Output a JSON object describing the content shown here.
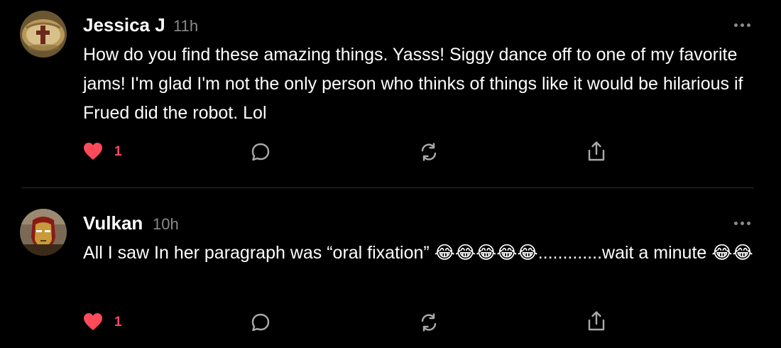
{
  "comments": [
    {
      "author": "Jessica J",
      "time": "11h",
      "text": "How do you find these amazing things. Yasss! Siggy dance off to one of my favorite jams! I'm glad I'm not the only person who thinks of things like it would be hilarious if Frued did the robot. Lol",
      "likes": "1",
      "avatar": "avatar-ring-cross",
      "liked": true
    },
    {
      "author": "Vulkan",
      "time": "10h",
      "text": "All I saw In her paragraph was “oral fixation” 😂😂😂😂😂.............wait a minute 😂😂",
      "likes": "1",
      "avatar": "avatar-iron-man",
      "liked": true
    }
  ],
  "icons": {
    "heart": "heart-icon",
    "reply": "comment-bubble-icon",
    "restack": "restack-icon",
    "share": "share-icon",
    "more": "more-options-icon"
  },
  "colors": {
    "background": "#000000",
    "text": "#ffffff",
    "muted": "#8a8a8a",
    "heart": "#ff4a5a",
    "divider": "#2a2a2a"
  }
}
